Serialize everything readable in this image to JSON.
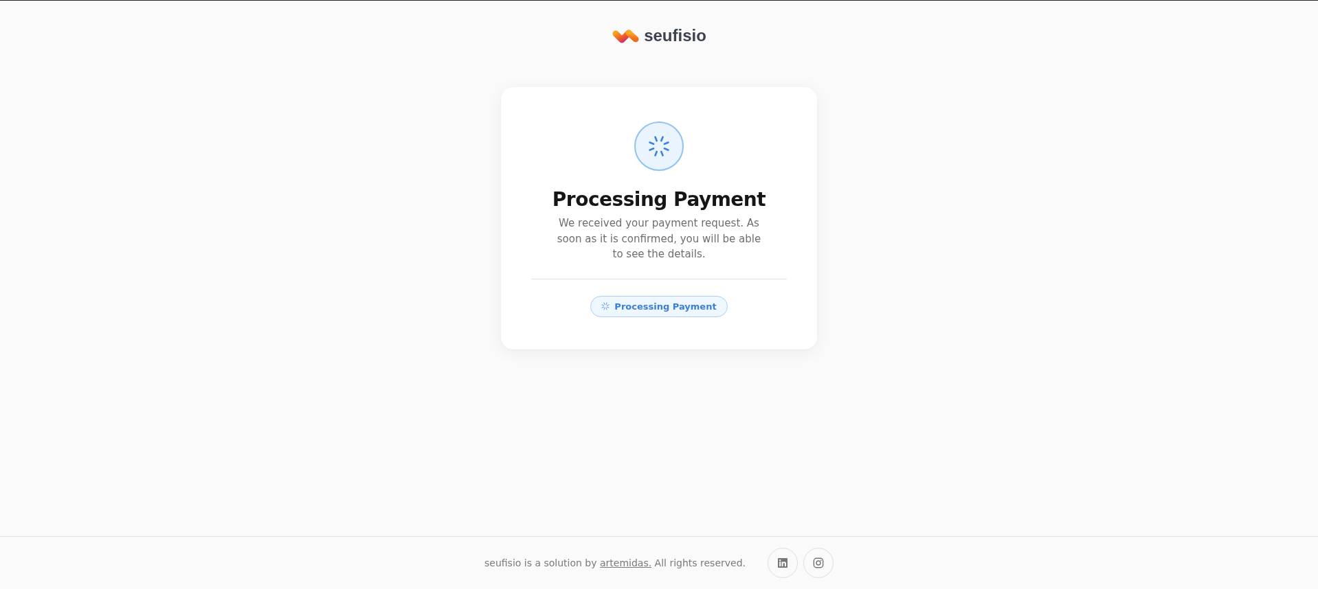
{
  "header": {
    "logo_text": "seufisio"
  },
  "card": {
    "title": "Processing Payment",
    "message": "We received your payment request. As soon as it is confirmed, you will be able to see the details.",
    "badge": {
      "label": "Processing Payment"
    }
  },
  "footer": {
    "before_link": "seufisio is a solution by",
    "link": "artemidas.",
    "after_link": "All rights reserved.",
    "social_links": [
      {
        "kind": "linkedin"
      },
      {
        "kind": "instagram"
      }
    ]
  }
}
